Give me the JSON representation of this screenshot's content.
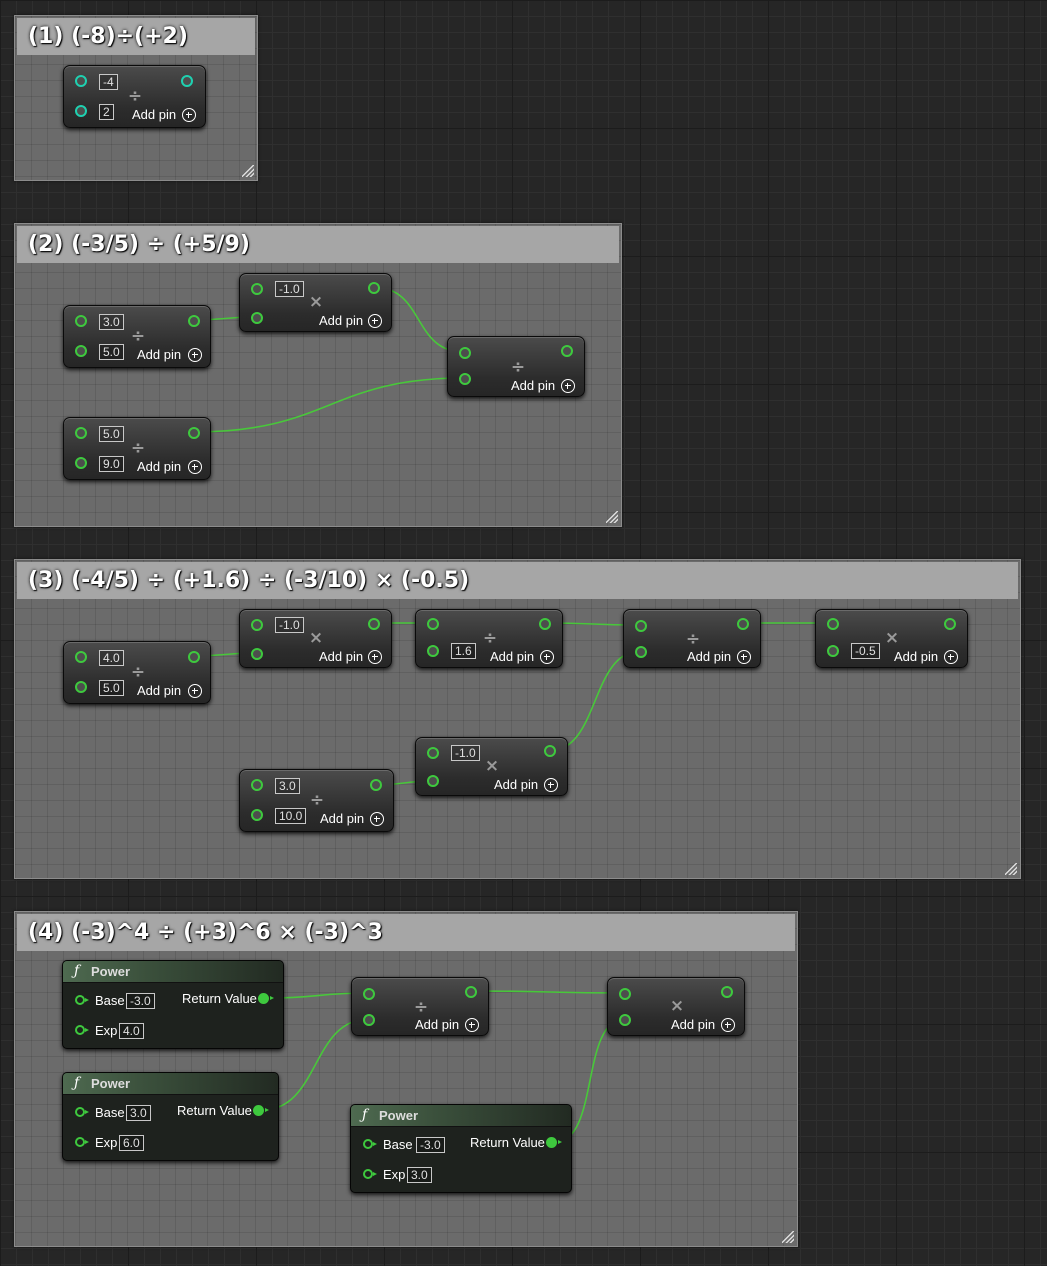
{
  "comments": [
    {
      "title": "(1) (-8)÷(+2)"
    },
    {
      "title": "(2) (-3/5) ÷ (+5/9)"
    },
    {
      "title": "(3) (-4/5) ÷ (+1.6) ÷ (-3/10) × (-0.5)"
    },
    {
      "title": "(4) (-3)^4 ÷ (+3)^6 × (-3)^3"
    }
  ],
  "add_pin_label": "Add pin",
  "ops": {
    "divide": "÷",
    "multiply": "×"
  },
  "nodes": {
    "c1_div": {
      "in1": "-4",
      "in2": "2"
    },
    "c2_div_a": {
      "in1": "3.0",
      "in2": "5.0"
    },
    "c2_mul": {
      "in1": "-1.0"
    },
    "c2_div_b": {
      "in1": "5.0",
      "in2": "9.0"
    },
    "c3_div_a": {
      "in1": "4.0",
      "in2": "5.0"
    },
    "c3_mul_a": {
      "in1": "-1.0"
    },
    "c3_div_b": {
      "in2": "1.6"
    },
    "c3_div_c": {
      "in1": "3.0",
      "in2": "10.0"
    },
    "c3_mul_b": {
      "in1": "-1.0"
    },
    "c3_mul_c": {
      "in2": "-0.5"
    }
  },
  "power_nodes": {
    "title": "Power",
    "function_icon": "ƒ",
    "base_label": "Base",
    "exp_label": "Exp",
    "return_label": "Return Value",
    "p1": {
      "base": "-3.0",
      "exp": "4.0"
    },
    "p2": {
      "base": "3.0",
      "exp": "6.0"
    },
    "p3": {
      "base": "-3.0",
      "exp": "3.0"
    }
  },
  "colors": {
    "wire": "#48c83a",
    "pin_green": "#3ec93e",
    "pin_teal": "#1fd0b0",
    "comment_header": "#a6a6a6",
    "comment_body": "#6b6b6b"
  }
}
